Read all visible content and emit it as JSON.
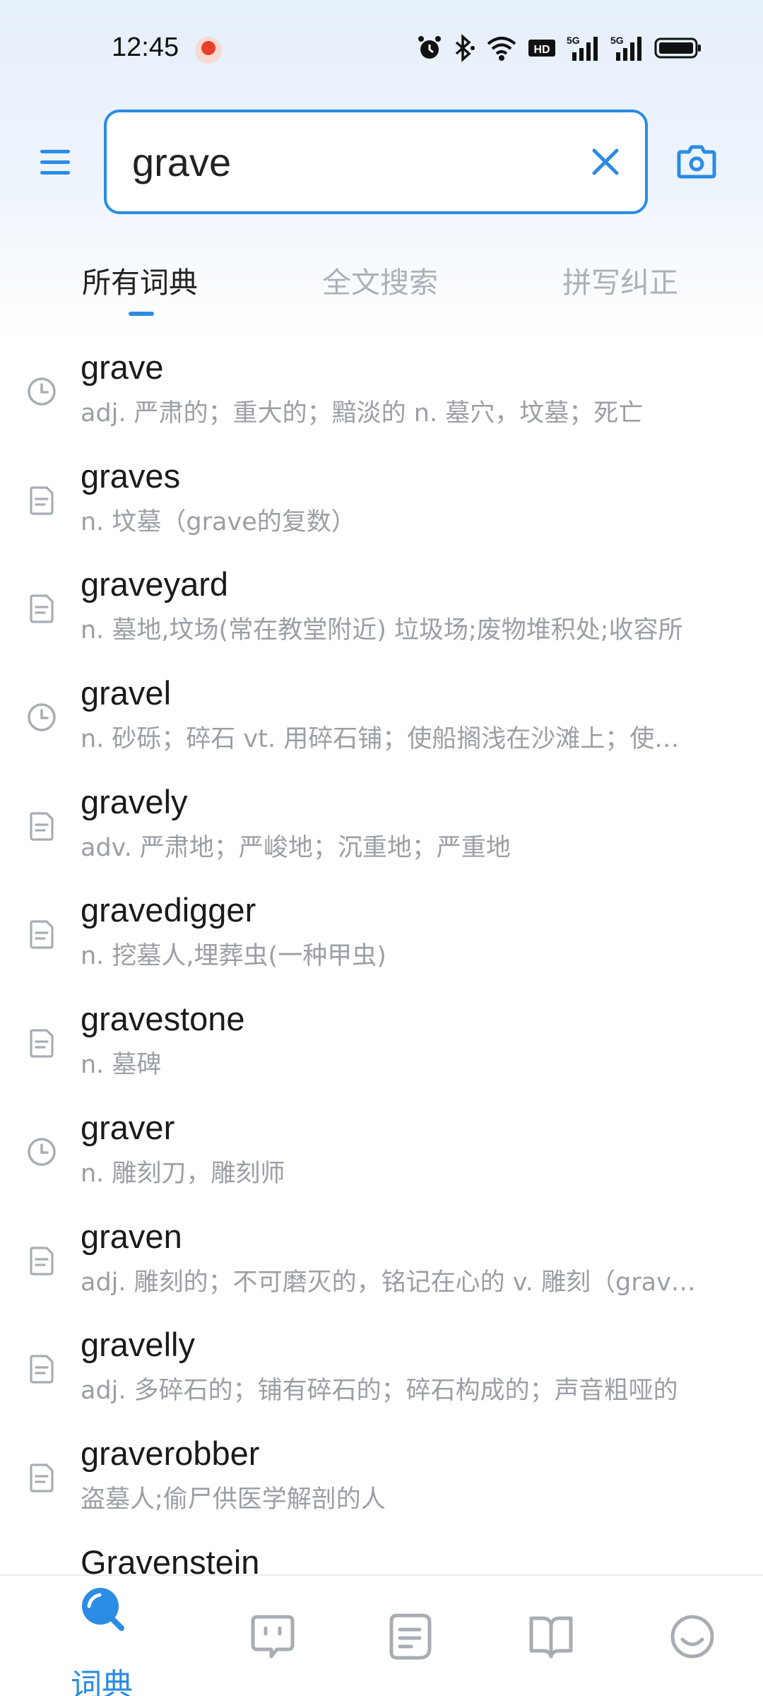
{
  "status_bar": {
    "time": "12:45",
    "icons": [
      "alarm-icon",
      "bluetooth-icon",
      "wifi-icon",
      "hd-icon",
      "5g-signal-icon",
      "5g-signal-icon",
      "battery-icon"
    ]
  },
  "search": {
    "value": "grave",
    "placeholder": ""
  },
  "tabs": [
    {
      "label": "所有词典",
      "active": true
    },
    {
      "label": "全文搜索",
      "active": false
    },
    {
      "label": "拼写纠正",
      "active": false
    }
  ],
  "results": [
    {
      "icon": "history",
      "word": "grave",
      "def": "adj. 严肃的；重大的；黯淡的 n. 墓穴，坟墓；死亡"
    },
    {
      "icon": "doc",
      "word": "graves",
      "def": "n. 坟墓（grave的复数）"
    },
    {
      "icon": "doc",
      "word": "graveyard",
      "def": "n. 墓地,坟场(常在教堂附近) 垃圾场;废物堆积处;收容所"
    },
    {
      "icon": "history",
      "word": "gravel",
      "def": "n. 砂砾；碎石 vt. 用碎石铺；使船搁浅在沙滩上；使…"
    },
    {
      "icon": "doc",
      "word": "gravely",
      "def": "adv. 严肃地；严峻地；沉重地；严重地"
    },
    {
      "icon": "doc",
      "word": "gravedigger",
      "def": "n. 挖墓人,埋葬虫(一种甲虫)"
    },
    {
      "icon": "doc",
      "word": "gravestone",
      "def": "n. 墓碑"
    },
    {
      "icon": "history",
      "word": "graver",
      "def": "n. 雕刻刀，雕刻师"
    },
    {
      "icon": "doc",
      "word": "graven",
      "def": "adj. 雕刻的；不可磨灭的，铭记在心的 v. 雕刻（grav…"
    },
    {
      "icon": "doc",
      "word": "gravelly",
      "def": "adj. 多碎石的；铺有碎石的；碎石构成的；声音粗哑的"
    },
    {
      "icon": "doc",
      "word": "graverobber",
      "def": "盗墓人;偷尸供医学解剖的人"
    },
    {
      "icon": "none",
      "word": "Gravenstein",
      "def": ""
    }
  ],
  "bottom_nav": [
    {
      "name": "dictionary",
      "icon": "search-icon",
      "label": "词典",
      "active": true
    },
    {
      "name": "chat",
      "icon": "chat-bot-icon",
      "label": "",
      "active": false
    },
    {
      "name": "notes",
      "icon": "document-icon",
      "label": "",
      "active": false
    },
    {
      "name": "wordbook",
      "icon": "book-icon",
      "label": "",
      "active": false
    },
    {
      "name": "profile",
      "icon": "smiley-icon",
      "label": "",
      "active": false
    }
  ],
  "colors": {
    "accent": "#2a8ce4",
    "icon_gray": "#a8adb3",
    "def_text": "#9a9fa6"
  }
}
